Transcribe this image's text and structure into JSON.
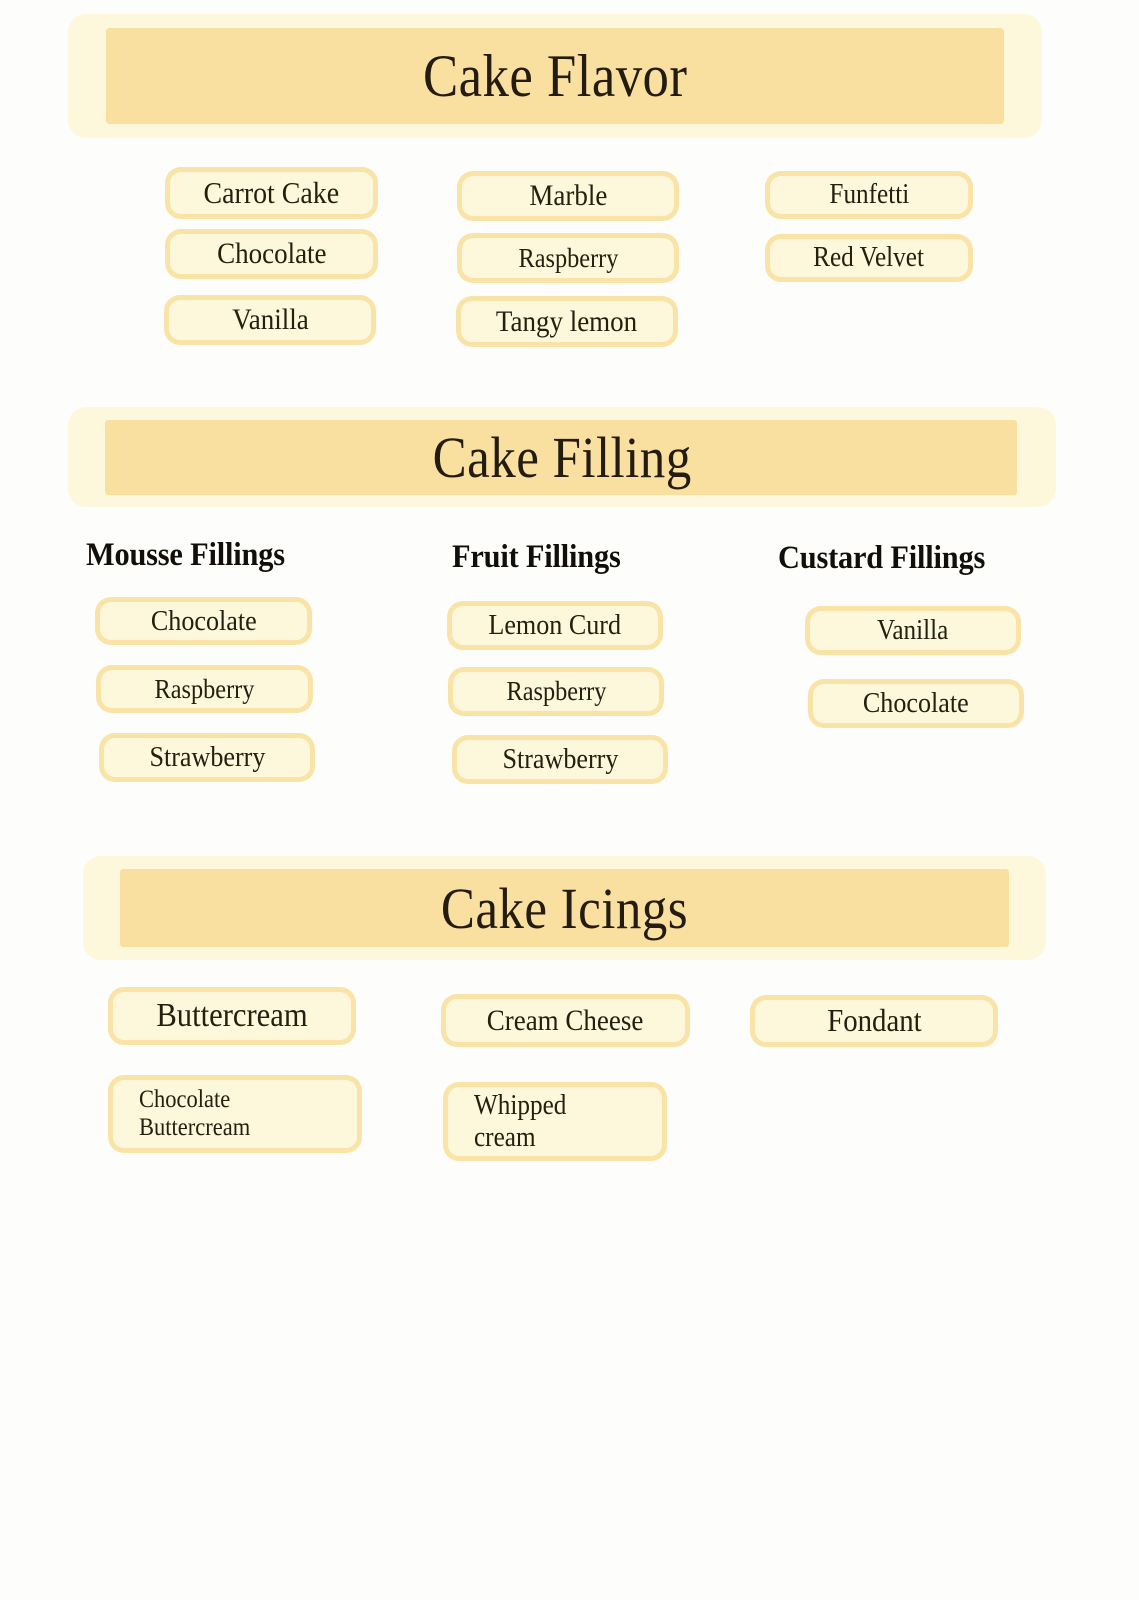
{
  "colors": {
    "page_background": "#fcfcfc",
    "header_outer": "#fdf8dc",
    "header_band": "#fae0a0",
    "chip_outer": "#fae3a6",
    "chip_inner": "#fdf7dc",
    "text_dark": "#23200f",
    "subhead_text": "#120f0a"
  },
  "sections": [
    {
      "id": "cake-flavor",
      "title": "Cake Flavor",
      "columns": [
        {
          "heading": "",
          "options": [
            "Carrot Cake",
            "Chocolate",
            "Vanilla"
          ]
        },
        {
          "heading": "",
          "options": [
            "Marble",
            "Raspberry",
            "Tangy lemon"
          ]
        },
        {
          "heading": "",
          "options": [
            "Funfetti",
            "Red Velvet"
          ]
        }
      ]
    },
    {
      "id": "cake-filling",
      "title": "Cake Filling",
      "columns": [
        {
          "heading": "Mousse Fillings",
          "options": [
            "Chocolate",
            "Raspberry",
            "Strawberry"
          ]
        },
        {
          "heading": "Fruit Fillings",
          "options": [
            "Lemon Curd",
            "Raspberry",
            "Strawberry"
          ]
        },
        {
          "heading": "Custard Fillings",
          "options": [
            "Vanilla",
            "Chocolate"
          ]
        }
      ]
    },
    {
      "id": "cake-icings",
      "title": "Cake Icings",
      "columns": [
        {
          "heading": "",
          "options": [
            "Buttercream",
            "Chocolate\nButtercream"
          ]
        },
        {
          "heading": "",
          "options": [
            "Cream Cheese",
            "Whipped\ncream"
          ]
        },
        {
          "heading": "",
          "options": [
            "Fondant"
          ]
        }
      ]
    }
  ]
}
